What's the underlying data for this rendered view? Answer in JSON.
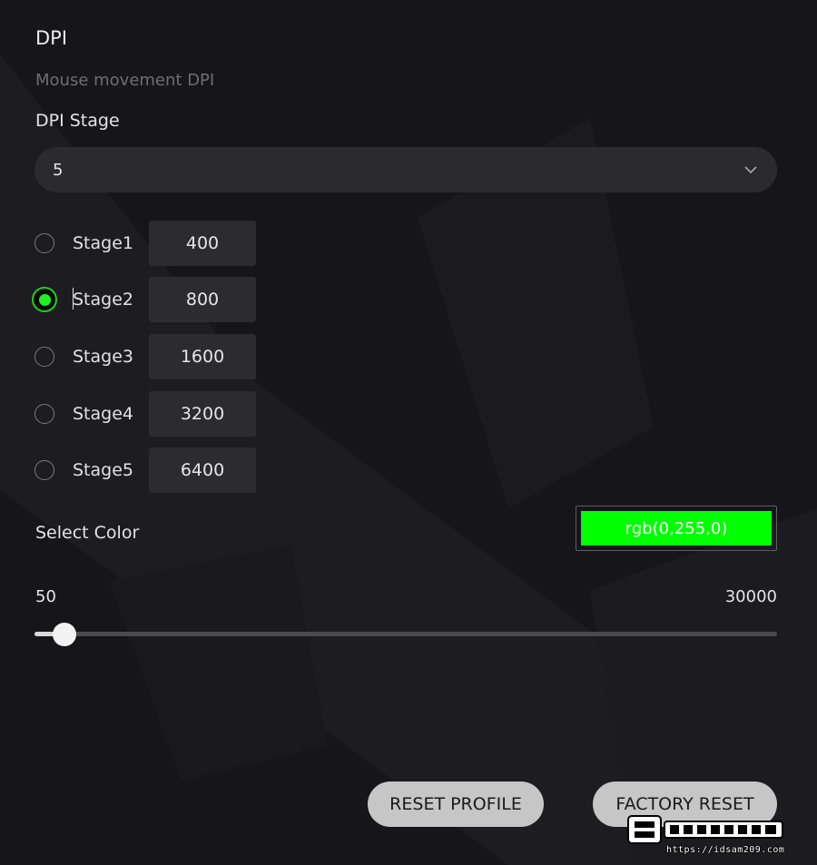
{
  "section": {
    "title": "DPI",
    "subtitle": "Mouse movement DPI"
  },
  "dpi_stage": {
    "label": "DPI Stage",
    "selected": "5"
  },
  "stages": [
    {
      "label": "Stage1",
      "value": "400",
      "selected": false
    },
    {
      "label": "Stage2",
      "value": "800",
      "selected": true
    },
    {
      "label": "Stage3",
      "value": "1600",
      "selected": false
    },
    {
      "label": "Stage4",
      "value": "3200",
      "selected": false
    },
    {
      "label": "Stage5",
      "value": "6400",
      "selected": false
    }
  ],
  "color": {
    "label": "Select Color",
    "value": "rgb(0,255,0)",
    "swatch": "#00ff00",
    "accent": "#22ee22"
  },
  "slider": {
    "min_label": "50",
    "max_label": "30000",
    "level": 0.04
  },
  "buttons": {
    "reset_profile": "RESET PROFILE",
    "factory_reset": "FACTORY RESET"
  },
  "watermark": {
    "url": "https://idsam209.com"
  },
  "icons": {
    "dropdown": "chevron-down-icon",
    "stage_radio": "radio-icon"
  }
}
